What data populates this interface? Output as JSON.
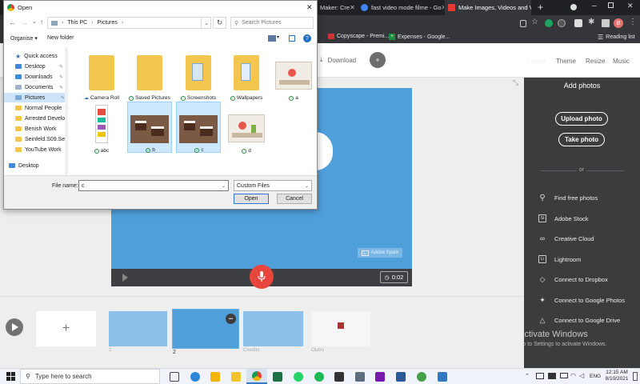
{
  "chrome": {
    "tabs": [
      {
        "label": "Maker: Cre",
        "active": false,
        "color": "#3b8fde"
      },
      {
        "label": "fast video mode filme - Go",
        "active": false,
        "color": "#4285f4"
      },
      {
        "label": "Make Images, Videos and V",
        "active": true,
        "color": "#e53935"
      }
    ],
    "new_tab": "+",
    "bookmarks": [
      "Copyscape - Premi...",
      "Expenses - Google..."
    ],
    "reading_list": "Reading list",
    "profile_badge": "B"
  },
  "spark": {
    "download_label": "Download",
    "nav": [
      "Layout",
      "Theme",
      "Resize",
      "Music"
    ],
    "slide_logo_text": "Adobe Spark",
    "timer": "0:02",
    "add_photos_title": "Add photos",
    "upload_label": "Upload photo",
    "take_label": "Take photo",
    "or_label": "or",
    "sources": [
      {
        "icon": "search-icon",
        "label": "Find free photos",
        "glyph": "⚲"
      },
      {
        "icon": "adobe-stock-icon",
        "label": "Adobe Stock",
        "glyph": "St"
      },
      {
        "icon": "creative-cloud-icon",
        "label": "Creative Cloud",
        "glyph": "∞"
      },
      {
        "icon": "lightroom-icon",
        "label": "Lightroom",
        "glyph": "Lr"
      },
      {
        "icon": "dropbox-icon",
        "label": "Connect to Dropbox",
        "glyph": "◇"
      },
      {
        "icon": "google-photos-icon",
        "label": "Connect to Google Photos",
        "glyph": "✦"
      },
      {
        "icon": "google-drive-icon",
        "label": "Connect to Google Drive",
        "glyph": "△"
      }
    ],
    "timeline": {
      "add_label": "+",
      "thumbs": [
        {
          "label": "1"
        },
        {
          "label": "2"
        },
        {
          "label": "Credits"
        },
        {
          "label": "Outro"
        }
      ],
      "more_label": "•••"
    }
  },
  "activate": {
    "title": "Activate Windows",
    "subtitle": "Go to Settings to activate Windows."
  },
  "dialog": {
    "title": "Open",
    "breadcrumb": [
      "This PC",
      "Pictures"
    ],
    "search_placeholder": "Search Pictures",
    "organise": "Organise ▾",
    "new_folder": "New folder",
    "tree": [
      {
        "label": "Quick access",
        "kind": "star"
      },
      {
        "label": "Desktop",
        "kind": "blue",
        "pin": true
      },
      {
        "label": "Downloads",
        "kind": "blue",
        "pin": true
      },
      {
        "label": "Documents",
        "kind": "doc",
        "pin": true
      },
      {
        "label": "Pictures",
        "kind": "pic",
        "pin": true,
        "selected": true
      },
      {
        "label": "Normal People",
        "kind": "folder",
        "pin": true
      },
      {
        "label": "Arrested Develo",
        "kind": "folder"
      },
      {
        "label": "Benish Work",
        "kind": "folder"
      },
      {
        "label": "Seinfeld.S09.Sea",
        "kind": "folder"
      },
      {
        "label": "YouTube Work",
        "kind": "folder"
      },
      {
        "label": "Desktop",
        "kind": "blue"
      }
    ],
    "files": [
      {
        "name": "Camera Roll",
        "type": "folder",
        "status": "cloud"
      },
      {
        "name": "Saved Pictures",
        "type": "folder",
        "status": "check"
      },
      {
        "name": "Screenshots",
        "type": "folder",
        "status": "check"
      },
      {
        "name": "Wallpapers",
        "type": "folder",
        "status": "check"
      },
      {
        "name": "a",
        "type": "image",
        "status": "check"
      },
      {
        "name": "abc",
        "type": "phone",
        "status": "check"
      },
      {
        "name": "b",
        "type": "cake",
        "status": "check",
        "selected": true
      },
      {
        "name": "c",
        "type": "cake",
        "status": "check",
        "selected": true
      },
      {
        "name": "d",
        "type": "image",
        "status": "check"
      }
    ],
    "filename_label": "File name:",
    "filename_value": "c",
    "filter_value": "Custom Files",
    "open_label": "Open",
    "cancel_label": "Cancel"
  },
  "taskbar": {
    "search_placeholder": "Type here to search",
    "lang": "ENG",
    "time": "12:15 AM",
    "date": "9/10/2021"
  }
}
